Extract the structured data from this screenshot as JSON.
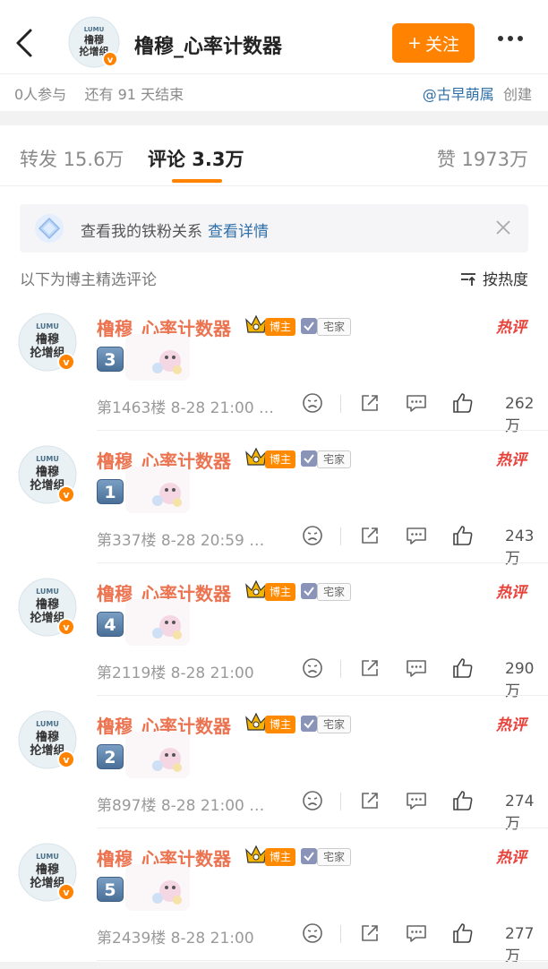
{
  "header": {
    "title": "橹穆_心率计数器",
    "follow_label": "关注",
    "follow_plus": "+",
    "avatar_text_top": "LUMU",
    "avatar_text_main1": "橹穆",
    "avatar_text_main2": "抡增组"
  },
  "subinfo": {
    "participants": "0人参与",
    "time_left": "还有 91 天结束",
    "creator": "@古早萌属",
    "created_label": "创建"
  },
  "tabs": [
    {
      "label": "转发 15.6万"
    },
    {
      "label": "评论 3.3万"
    },
    {
      "label": "赞 1973万"
    }
  ],
  "fan_banner": {
    "text": "查看我的铁粉关系",
    "link": "查看详情"
  },
  "section": {
    "label": "以下为博主精选评论",
    "sort_label": "按热度"
  },
  "badges": {
    "bozhu": "博主",
    "zhaijia": "宅家",
    "hot": "热评"
  },
  "comments": [
    {
      "name": "橹穆_心率计数器",
      "key": "3",
      "meta": "第1463楼 8-28 21:00 …",
      "likes": "262万"
    },
    {
      "name": "橹穆_心率计数器",
      "key": "1",
      "meta": "第337楼 8-28 20:59 …",
      "likes": "243万"
    },
    {
      "name": "橹穆_心率计数器",
      "key": "4",
      "meta": "第2119楼 8-28 21:00",
      "likes": "290万"
    },
    {
      "name": "橹穆_心率计数器",
      "key": "2",
      "meta": "第897楼 8-28 21:00 …",
      "likes": "274万"
    },
    {
      "name": "橹穆_心率计数器",
      "key": "5",
      "meta": "第2439楼 8-28 21:00",
      "likes": "277万"
    }
  ],
  "colors": {
    "accent": "#ff8200",
    "name": "#eb7350",
    "link": "#2f6fa8",
    "hot": "#e8413a"
  }
}
